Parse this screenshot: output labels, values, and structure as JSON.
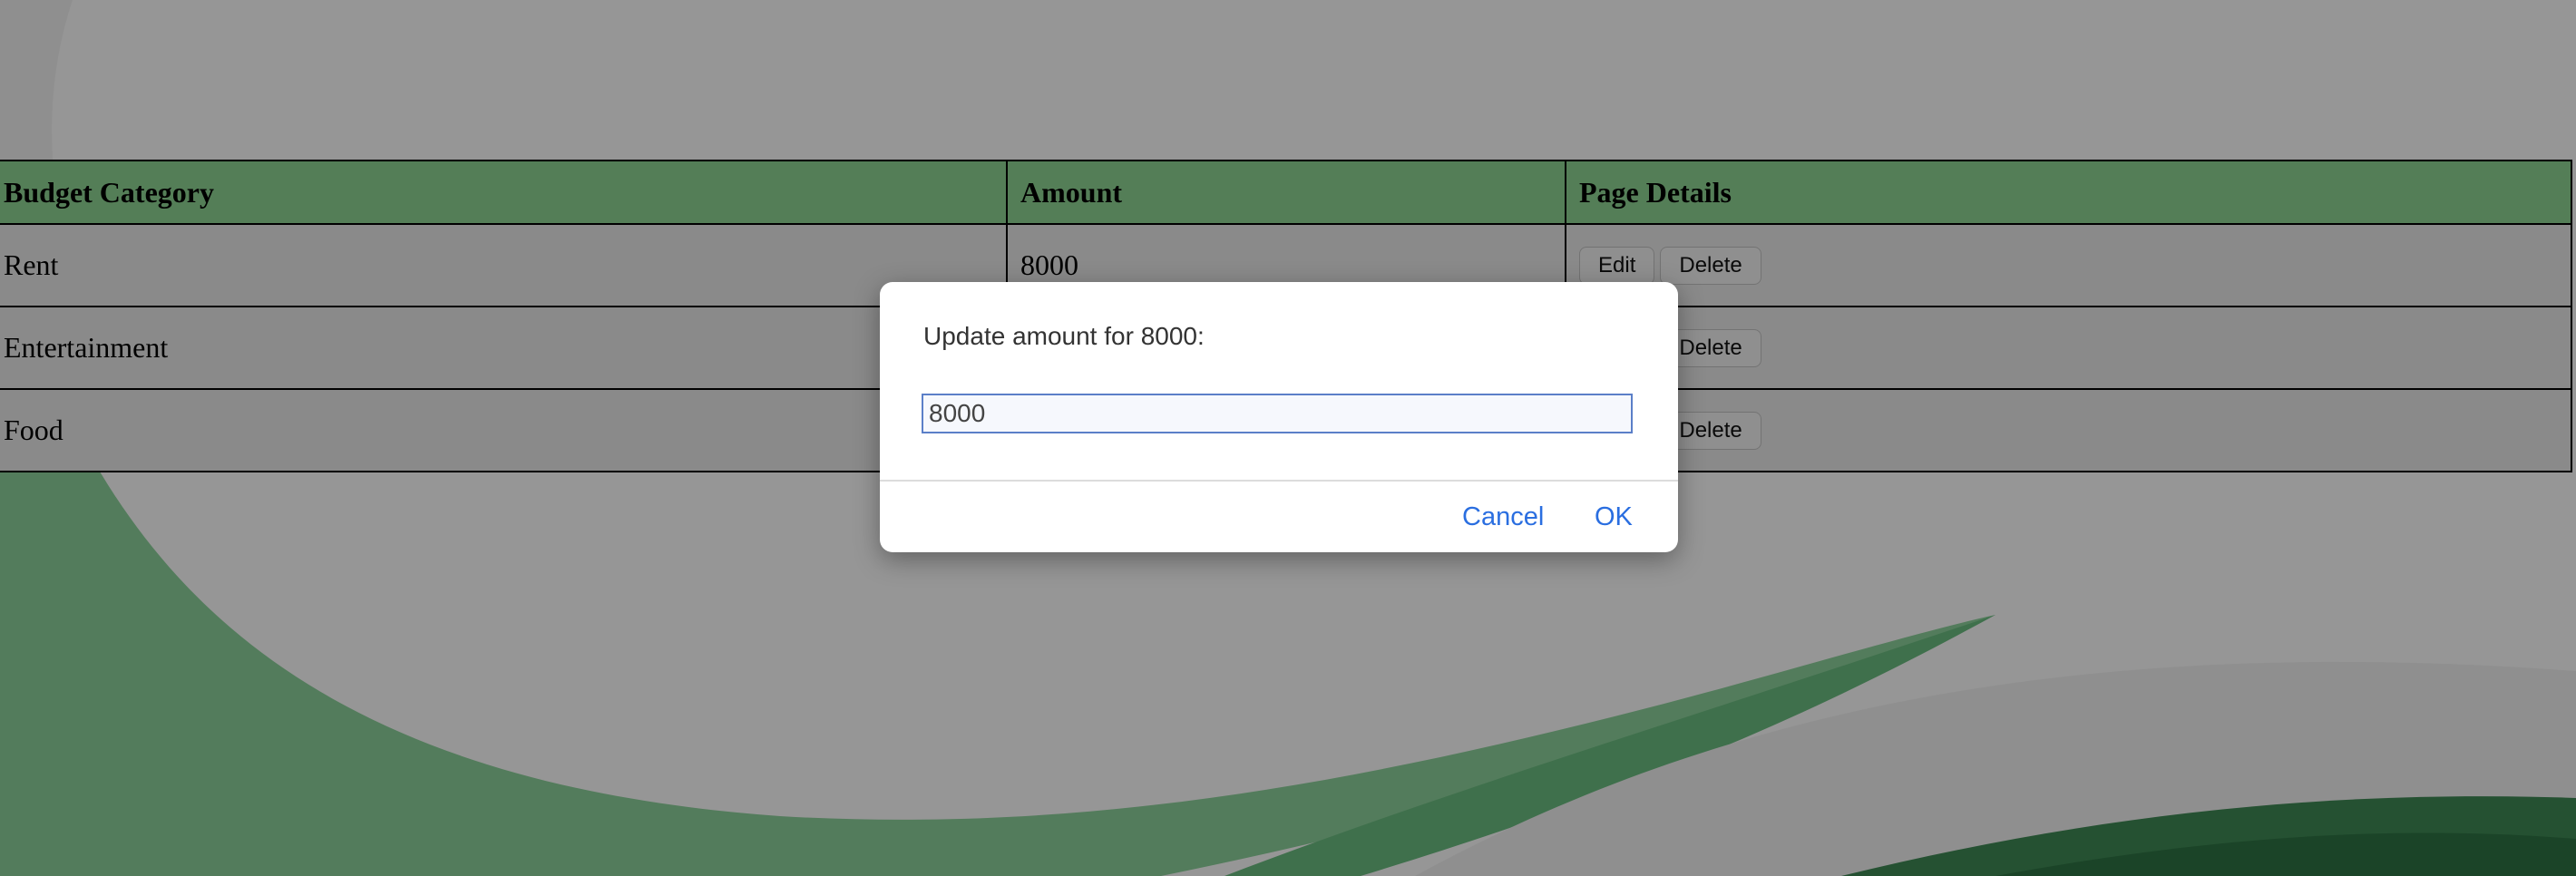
{
  "table": {
    "headers": [
      "Budget Category",
      "Amount",
      "Page Details"
    ],
    "rows": [
      {
        "category": "Rent",
        "amount": "8000"
      },
      {
        "category": "Entertainment",
        "amount": ""
      },
      {
        "category": "Food",
        "amount": ""
      }
    ],
    "edit_label": "Edit",
    "delete_label": "Delete"
  },
  "dialog": {
    "message": "Update amount for 8000:",
    "input_value": "8000",
    "cancel_label": "Cancel",
    "ok_label": "OK"
  },
  "colors": {
    "header_bg": "#8fd694",
    "wave_green": "#4a9a62",
    "link_blue": "#2a6ee0"
  }
}
